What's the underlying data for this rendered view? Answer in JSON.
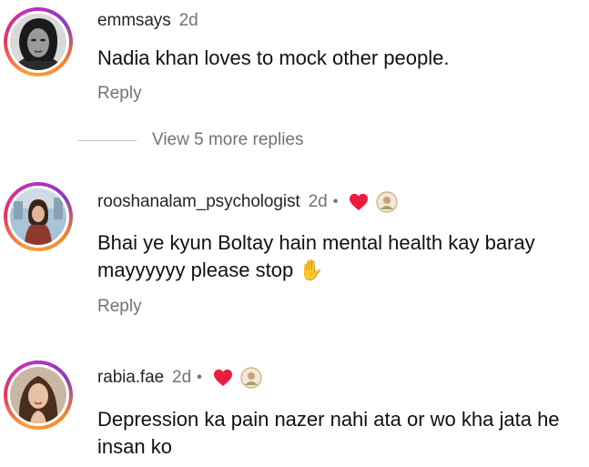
{
  "comments": [
    {
      "username": "emmsays",
      "time": "2d",
      "text": "Nadia khan loves to mock other people.",
      "reply_label": "Reply",
      "liked_by_author": false
    },
    {
      "username": "rooshanalam_psychologist",
      "time": "2d",
      "dot": "•",
      "text": "Bhai ye kyun Boltay hain mental health kay baray mayyyyyy please stop ✋",
      "reply_label": "Reply",
      "liked_by_author": true
    },
    {
      "username": "rabia.fae",
      "time": "2d",
      "dot": "•",
      "text": "Depression ka pain nazer nahi ata  or wo kha jata he insan ko",
      "liked_by_author": true
    }
  ],
  "view_more_replies": "View 5 more replies",
  "colors": {
    "heart": "#ed1c3f",
    "secondary_text": "#737373",
    "ring_gradient": [
      "#f9a23c",
      "#e8365d",
      "#c22ec2"
    ]
  }
}
